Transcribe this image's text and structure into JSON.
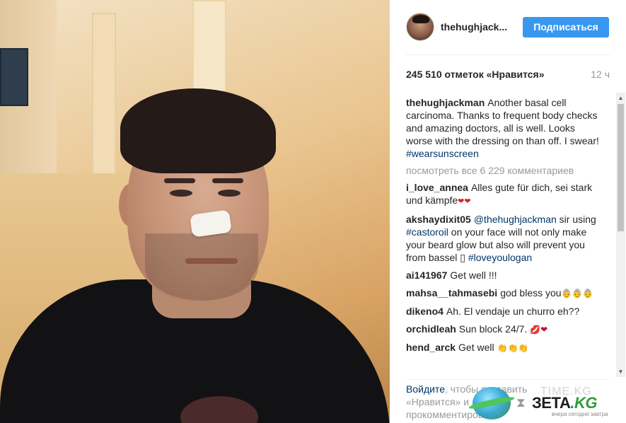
{
  "post": {
    "username": "thehughjack...",
    "follow_label": "Подписаться",
    "likes": "245 510 отметок «Нравится»",
    "time": "12 ч"
  },
  "caption": {
    "author": "thehughjackman",
    "text": "Another basal cell carcinoma. Thanks to frequent body checks and amazing doctors, all is well. Looks worse with the dressing on than off. I swear!",
    "hashtag": "#wearsunscreen"
  },
  "view_all": "посмотреть все 6 229 комментариев",
  "comments": [
    {
      "author": "i_love_annea",
      "pre": "Alles gute für dich, sei stark und kämpfe",
      "tag": "",
      "post": "",
      "emoji": "❤❤"
    },
    {
      "author": "akshaydixit05",
      "pre": "",
      "tag": "@thehughjackman",
      "post": " sir using ",
      "tag2": "#castoroil",
      "post2": " on your face will not only make your beard glow but also will prevent you from bassel ",
      "emoji": "▯",
      "tag3": "#loveyoulogan"
    },
    {
      "author": "ai141967",
      "pre": "Get well !!!",
      "tag": "",
      "post": "",
      "emoji": ""
    },
    {
      "author": "mahsa__tahmasebi",
      "pre": "god bless you",
      "tag": "",
      "post": "",
      "emoji": "👵👵👵"
    },
    {
      "author": "dikeno4",
      "pre": "Ah. El vendaje un churro eh??",
      "tag": "",
      "post": "",
      "emoji": ""
    },
    {
      "author": "orchidleah",
      "pre": "Sun block 24/7.",
      "tag": "",
      "post": "",
      "emoji": "💋❤"
    },
    {
      "author": "hend_arck",
      "pre": "Get well",
      "tag": "",
      "post": "",
      "emoji": "👏👏👏"
    }
  ],
  "login": {
    "link": "Войдите",
    "text1": ", чтобы поставить",
    "text2": "«Нравится» и",
    "text3": "прокомментировать."
  },
  "watermark": {
    "brand": "ЗЕТА",
    "tld": ".KG",
    "subtitle": "вчера сегодня завтра",
    "ghost": "TIME.KG"
  },
  "colors": {
    "accent": "#3897f0",
    "link": "#003569",
    "muted": "#999999"
  }
}
